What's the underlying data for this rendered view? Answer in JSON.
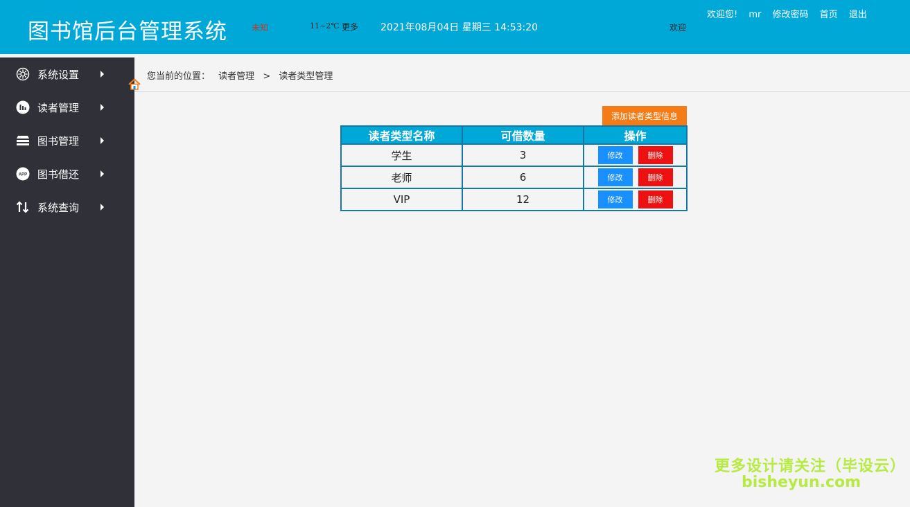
{
  "header": {
    "title": "图书馆后台管理系统",
    "weather_city": "未知",
    "weather_temp": "11~2℃",
    "weather_more": "更多",
    "datetime": "2021年08月04日 星期三 14:53:20",
    "welcome_small": "欢迎",
    "welcome": "欢迎您!",
    "username": "mr",
    "change_password": "修改密码",
    "home": "首页",
    "logout": "退出"
  },
  "sidebar": {
    "items": [
      {
        "label": "系统设置",
        "icon": "gear-icon"
      },
      {
        "label": "读者管理",
        "icon": "bar-chart-icon"
      },
      {
        "label": "图书管理",
        "icon": "books-stack-icon"
      },
      {
        "label": "图书借还",
        "icon": "app-icon"
      },
      {
        "label": "系统查询",
        "icon": "swap-arrows-icon"
      }
    ]
  },
  "breadcrumb": {
    "prefix": "您当前的位置：",
    "level1": "读者管理",
    "separator": ">",
    "level2": "读者类型管理"
  },
  "add_button": "添加读者类型信息",
  "table": {
    "headers": [
      "读者类型名称",
      "可借数量",
      "操作"
    ],
    "rows": [
      {
        "name": "学生",
        "count": "3"
      },
      {
        "name": "老师",
        "count": "6"
      },
      {
        "name": "VIP",
        "count": "12"
      }
    ],
    "edit_label": "修改",
    "delete_label": "删除"
  },
  "watermark": {
    "line1": "更多设计请关注（毕设云）",
    "line2": "bisheyun.com"
  },
  "colors": {
    "header_bg": "#00a8d8",
    "sidebar_bg": "#2f3038",
    "add_button": "#f47b16",
    "edit_button": "#1890ff",
    "delete_button": "#ee1111"
  }
}
